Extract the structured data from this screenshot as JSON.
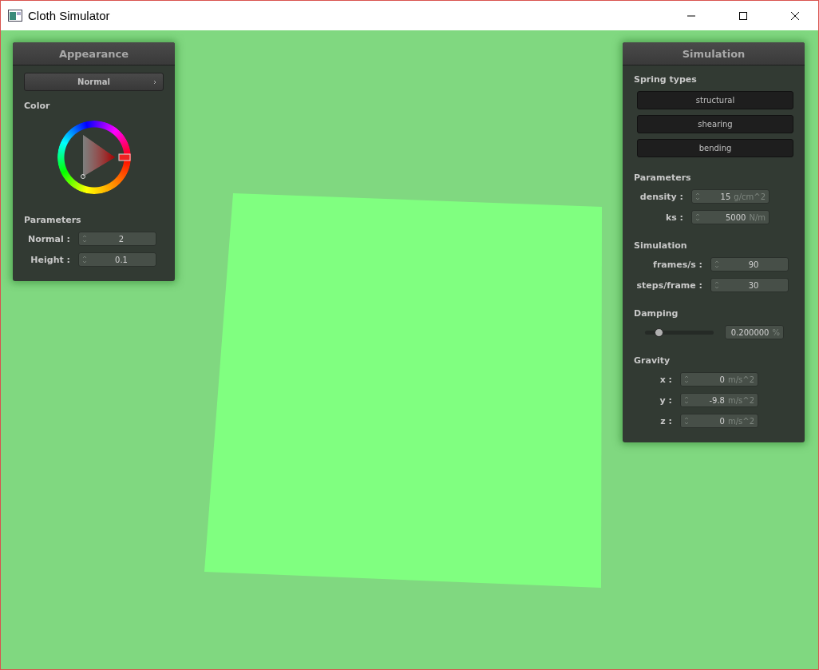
{
  "window": {
    "title": "Cloth Simulator"
  },
  "appearance": {
    "title": "Appearance",
    "mode": "Normal",
    "color_label": "Color",
    "parameters_label": "Parameters",
    "fields": [
      {
        "label": "Normal :",
        "value": "2"
      },
      {
        "label": "Height :",
        "value": "0.1"
      }
    ]
  },
  "simulation": {
    "title": "Simulation",
    "spring_label": "Spring types",
    "springs": [
      "structural",
      "shearing",
      "bending"
    ],
    "parameters_label": "Parameters",
    "parameters": [
      {
        "label": "density :",
        "value": "15",
        "unit": "g/cm^2"
      },
      {
        "label": "ks :",
        "value": "5000",
        "unit": "N/m"
      }
    ],
    "simulation_label": "Simulation",
    "simulation_fields": [
      {
        "label": "frames/s :",
        "value": "90"
      },
      {
        "label": "steps/frame :",
        "value": "30"
      }
    ],
    "damping_label": "Damping",
    "damping": {
      "level": 0.2,
      "value": "0.200000",
      "unit": "%"
    },
    "gravity_label": "Gravity",
    "gravity": [
      {
        "label": "x :",
        "value": "0",
        "unit": "m/s^2"
      },
      {
        "label": "y :",
        "value": "-9.8",
        "unit": "m/s^2"
      },
      {
        "label": "z :",
        "value": "0",
        "unit": "m/s^2"
      }
    ]
  }
}
